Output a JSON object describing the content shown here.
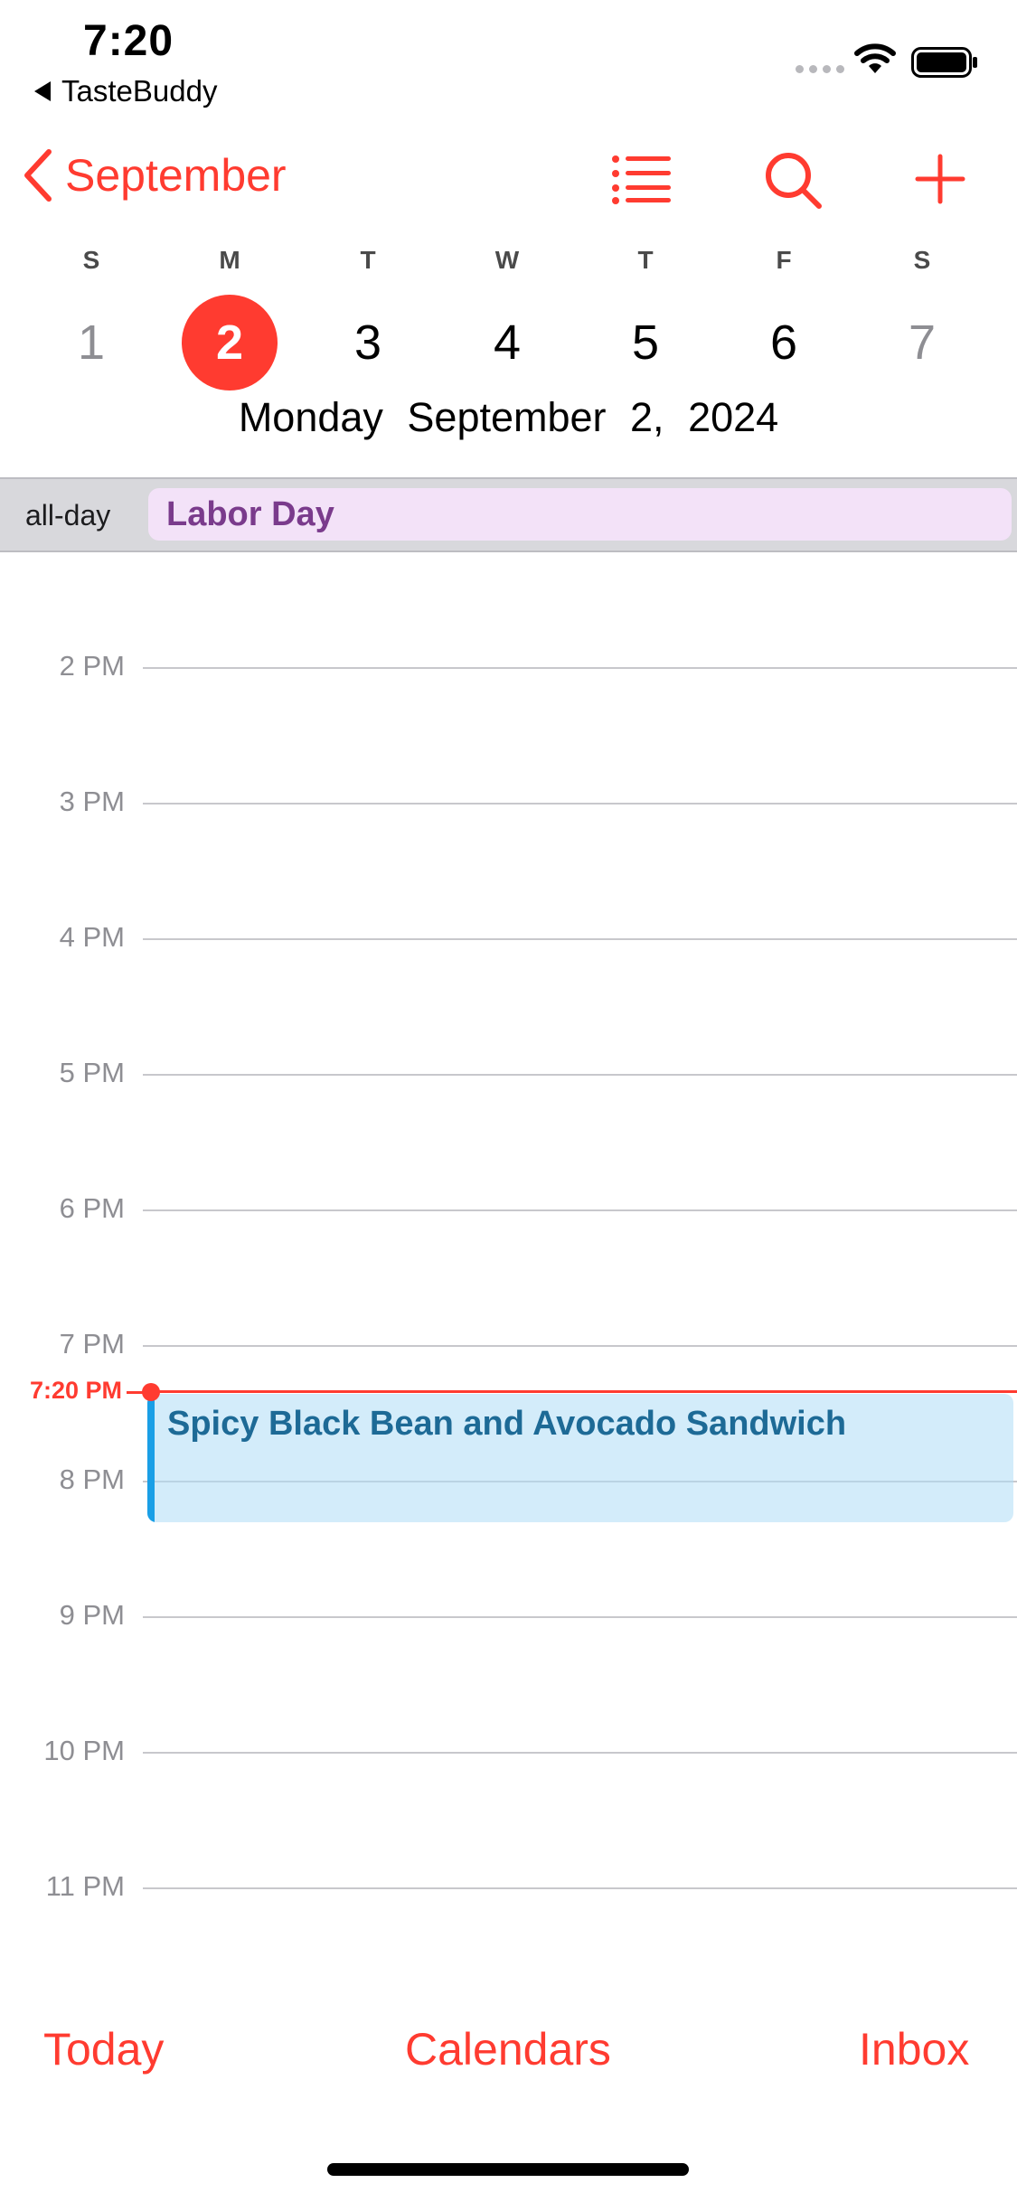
{
  "status_bar": {
    "time": "7:20",
    "back_app": "TasteBuddy"
  },
  "nav": {
    "month_label": "September",
    "accent_color": "#ff3b30"
  },
  "week": {
    "days": [
      {
        "letter": "S",
        "number": "1"
      },
      {
        "letter": "M",
        "number": "2"
      },
      {
        "letter": "T",
        "number": "3"
      },
      {
        "letter": "W",
        "number": "4"
      },
      {
        "letter": "T",
        "number": "5"
      },
      {
        "letter": "F",
        "number": "6"
      },
      {
        "letter": "S",
        "number": "7"
      }
    ],
    "selected_day": "2",
    "date_title": "Monday September 2, 2024"
  },
  "all_day": {
    "label": "all-day",
    "event": "Labor Day",
    "event_color": "#f3e2f8"
  },
  "timeline": {
    "hours": [
      "2 PM",
      "3 PM",
      "4 PM",
      "5 PM",
      "6 PM",
      "7 PM",
      "8 PM",
      "9 PM",
      "10 PM",
      "11 PM"
    ],
    "now_label": "7:20 PM",
    "event": {
      "title": "Spicy Black Bean and Avocado Sandwich",
      "color": "#1a9fe6"
    }
  },
  "toolbar": {
    "today": "Today",
    "calendars": "Calendars",
    "inbox": "Inbox"
  }
}
